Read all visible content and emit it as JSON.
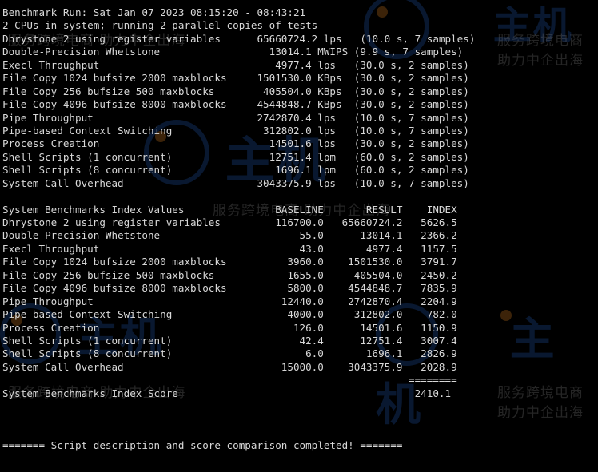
{
  "watermark": {
    "brand": "主机",
    "tagline": "服务跨境电商 助力中企出海"
  },
  "terminal": {
    "header": [
      "Benchmark Run: Sat Jan 07 2023 08:15:20 - 08:43:21",
      "2 CPUs in system; running 2 parallel copies of tests"
    ],
    "results": [
      "Dhrystone 2 using register variables      65660724.2 lps   (10.0 s, 7 samples)",
      "Double-Precision Whetstone                  13014.1 MWIPS (9.9 s, 7 samples)",
      "Execl Throughput                             4977.4 lps   (30.0 s, 2 samples)",
      "File Copy 1024 bufsize 2000 maxblocks     1501530.0 KBps  (30.0 s, 2 samples)",
      "File Copy 256 bufsize 500 maxblocks        405504.0 KBps  (30.0 s, 2 samples)",
      "File Copy 4096 bufsize 8000 maxblocks     4544848.7 KBps  (30.0 s, 2 samples)",
      "Pipe Throughput                           2742870.4 lps   (10.0 s, 7 samples)",
      "Pipe-based Context Switching               312802.0 lps   (10.0 s, 7 samples)",
      "Process Creation                            14501.6 lps   (30.0 s, 2 samples)",
      "Shell Scripts (1 concurrent)                12751.4 lpm   (60.0 s, 2 samples)",
      "Shell Scripts (8 concurrent)                 1696.1 lpm   (60.0 s, 2 samples)",
      "System Call Overhead                      3043375.9 lps   (10.0 s, 7 samples)"
    ],
    "blank1": "",
    "index_header": "System Benchmarks Index Values               BASELINE       RESULT    INDEX",
    "index_rows": [
      "Dhrystone 2 using register variables         116700.0   65660724.2   5626.5",
      "Double-Precision Whetstone                       55.0      13014.1   2366.2",
      "Execl Throughput                                 43.0       4977.4   1157.5",
      "File Copy 1024 bufsize 2000 maxblocks          3960.0    1501530.0   3791.7",
      "File Copy 256 bufsize 500 maxblocks            1655.0     405504.0   2450.2",
      "File Copy 4096 bufsize 8000 maxblocks          5800.0    4544848.7   7835.9",
      "Pipe Throughput                               12440.0    2742870.4   2204.9",
      "Pipe-based Context Switching                   4000.0     312802.0    782.0",
      "Process Creation                                126.0      14501.6   1150.9",
      "Shell Scripts (1 concurrent)                     42.4      12751.4   3007.4",
      "Shell Scripts (8 concurrent)                      6.0       1696.1   2826.9",
      "System Call Overhead                          15000.0    3043375.9   2028.9"
    ],
    "separator": "                                                                   ========",
    "score": "System Benchmarks Index Score                                       2410.1",
    "blank2": "",
    "blank3": "",
    "blank4": "",
    "footer": "======= Script description and score comparison completed! ======="
  }
}
